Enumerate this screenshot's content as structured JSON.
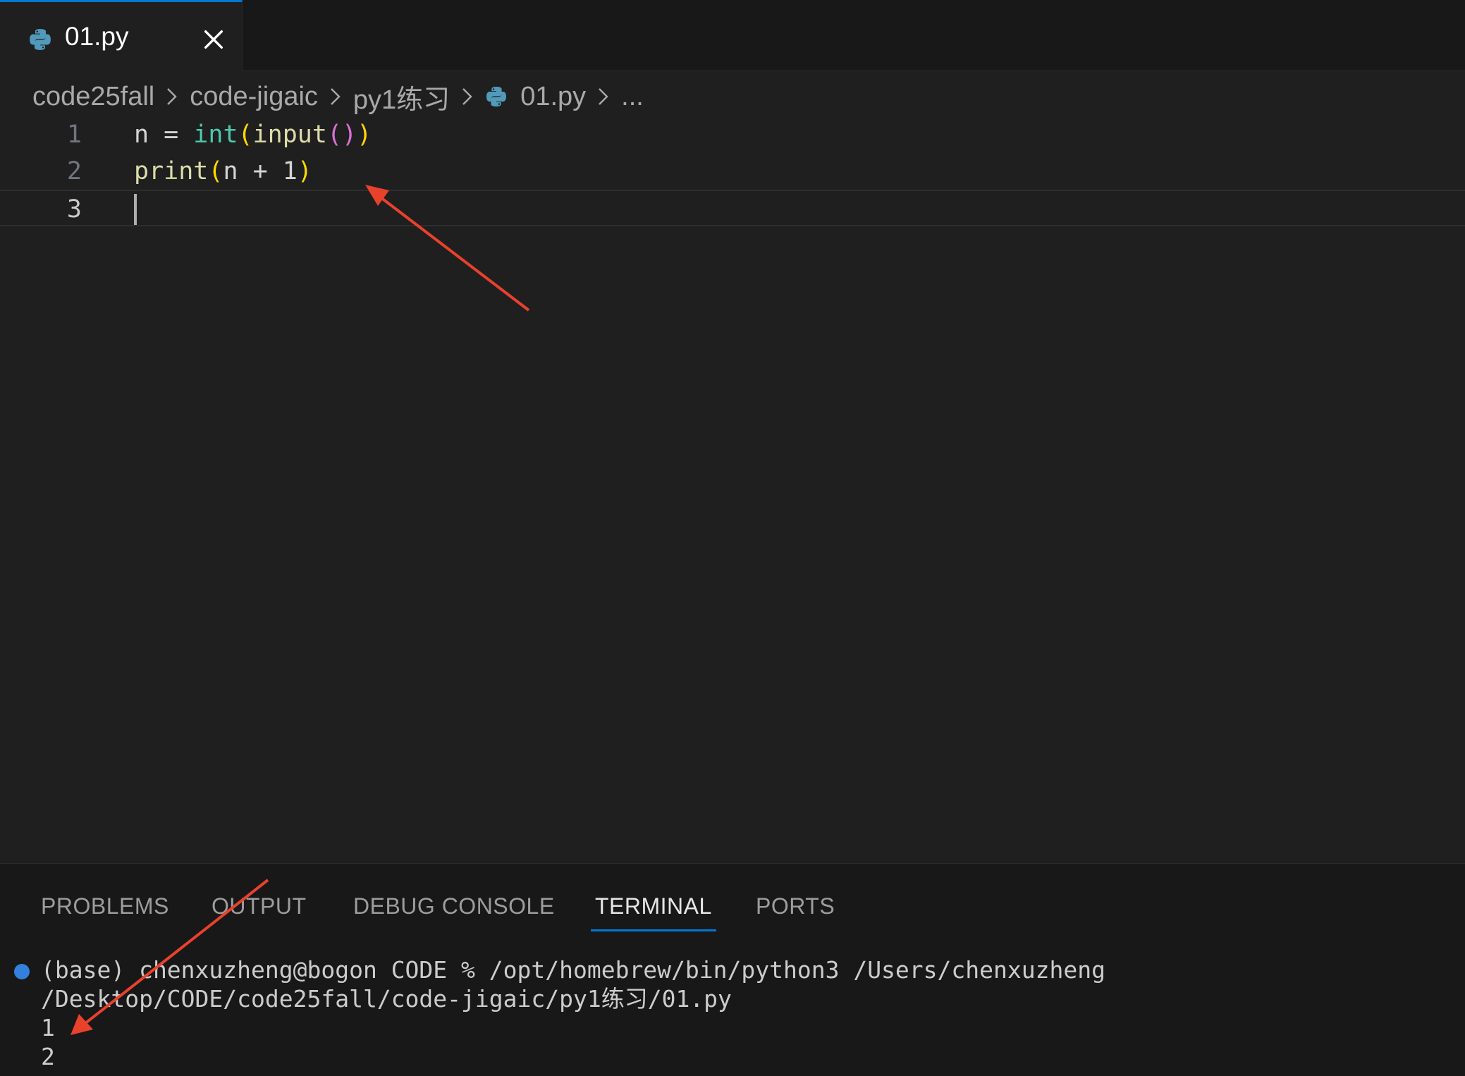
{
  "tab": {
    "label": "01.py",
    "icon": "python-icon",
    "close_icon": "close-icon"
  },
  "breadcrumb": {
    "items": [
      "code25fall",
      "code-jigaic",
      "py1练习",
      "01.py",
      "..."
    ],
    "separator_icon": "chevron-right-icon"
  },
  "editor": {
    "lines": [
      {
        "number": "1",
        "tokens": [
          "n",
          " = ",
          "int",
          "(",
          "input",
          "()",
          ")"
        ]
      },
      {
        "number": "2",
        "tokens": [
          "print",
          "(",
          "n + 1",
          ")"
        ]
      },
      {
        "number": "3",
        "tokens": []
      }
    ],
    "current_line": 3
  },
  "panel": {
    "tabs": [
      "PROBLEMS",
      "OUTPUT",
      "DEBUG CONSOLE",
      "TERMINAL",
      "PORTS"
    ],
    "active_tab": "TERMINAL"
  },
  "terminal": {
    "lines": [
      "(base) chenxuzheng@bogon CODE % /opt/homebrew/bin/python3 /Users/chenxuzheng",
      "/Desktop/CODE/code25fall/code-jigaic/py1练习/01.py",
      "1",
      "2"
    ]
  },
  "colors": {
    "accent": "#0078d4",
    "annotation_arrow": "#e8412c",
    "editor_bg": "#1f1f1f",
    "panel_bg": "#181818"
  }
}
